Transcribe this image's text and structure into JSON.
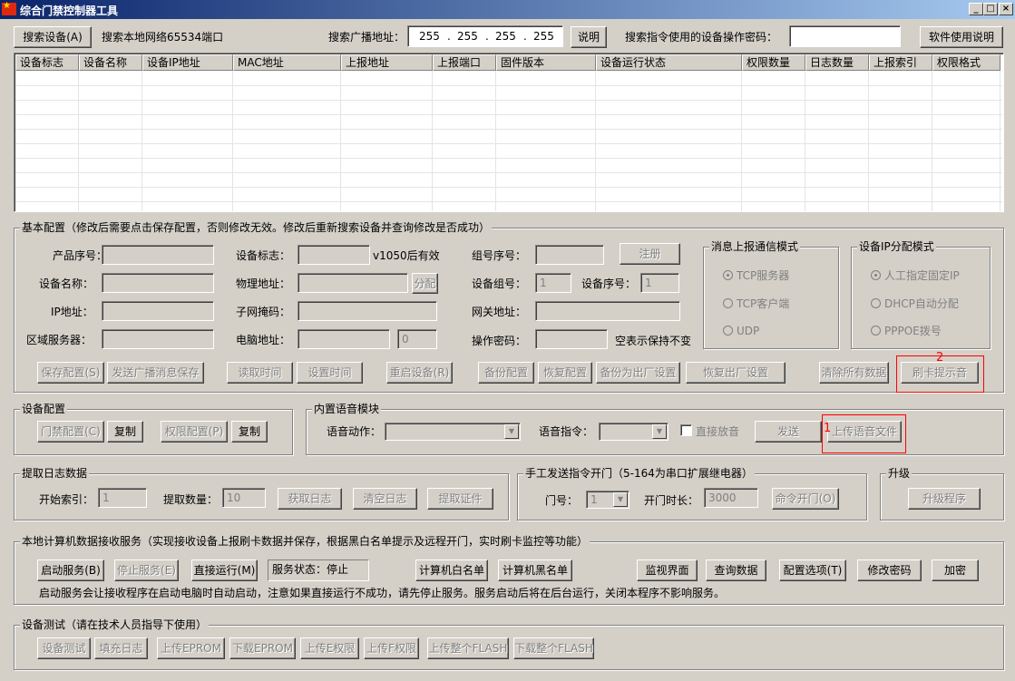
{
  "window": {
    "title": "综合门禁控制器工具",
    "minimize": "_",
    "maximize": "□",
    "close": "×"
  },
  "top": {
    "search_button": "搜索设备(A)",
    "search_port_label": "搜索本地网络65534端口",
    "broadcast_label": "搜索广播地址：",
    "broadcast_octets": [
      "255",
      "255",
      "255",
      "255"
    ],
    "explain_button": "说明",
    "password_label": "搜索指令使用的设备操作密码：",
    "password_value": "",
    "manual_button": "软件使用说明"
  },
  "device_list": {
    "columns": [
      "设备标志",
      "设备名称",
      "设备IP地址",
      "MAC地址",
      "上报地址",
      "上报端口",
      "固件版本",
      "设备运行状态",
      "权限数量",
      "日志数量",
      "上报索引",
      "权限格式"
    ]
  },
  "basic_config": {
    "title": "基本配置（修改后需要点击保存配置，否则修改无效。修改后重新搜索设备并查询修改是否成功）",
    "product_sn_label": "产品序号：",
    "device_name_label": "设备名称：",
    "ip_label": "IP地址：",
    "zone_server_label": "区域服务器：",
    "device_flag_label": "设备标志：",
    "version_note": "v1050后有效",
    "mac_label": "物理地址：",
    "assign_button": "分配",
    "subnet_label": "子网掩码：",
    "pc_addr_label": "电脑地址：",
    "pc_port_value": "0",
    "group_sn_label": "组号序号：",
    "register_button": "注册",
    "device_group_label": "设备组号：",
    "device_group_value": "1",
    "device_sn_label": "设备序号：",
    "device_sn_value": "1",
    "gateway_label": "网关地址：",
    "op_password_label": "操作密码：",
    "empty_keep_note": "空表示保持不变",
    "msg_mode": {
      "title": "消息上报通信模式",
      "options": [
        "TCP服务器",
        "TCP客户端",
        "UDP"
      ],
      "selected": 0
    },
    "ip_mode": {
      "title": "设备IP分配模式",
      "options": [
        "人工指定固定IP",
        "DHCP自动分配",
        "PPPOE拨号"
      ],
      "selected": 0
    },
    "buttons": [
      "保存配置(S)",
      "发送广播消息保存",
      "读取时间",
      "设置时间",
      "重启设备(R)",
      "备份配置",
      "恢复配置",
      "备份为出厂设置",
      "恢复出厂设置",
      "清除所有数据",
      "刷卡提示音"
    ],
    "marker_2": "2"
  },
  "device_config": {
    "title": "设备配置",
    "door_config_button": "门禁配置(C)",
    "copy1_button": "复制",
    "perm_config_button": "权限配置(P)",
    "copy2_button": "复制"
  },
  "voice": {
    "title": "内置语音模块",
    "action_label": "语音动作：",
    "command_label": "语音指令：",
    "direct_play_label": "直接放音",
    "send_button": "发送",
    "upload_button": "上传语音文件",
    "marker_1": "1"
  },
  "log": {
    "title": "提取日志数据",
    "start_index_label": "开始索引：",
    "start_index_value": "1",
    "count_label": "提取数量：",
    "count_value": "10",
    "get_log_button": "获取日志",
    "clear_log_button": "清空日志",
    "get_cert_button": "提取证件"
  },
  "manual_open": {
    "title": "手工发送指令开门（5-164为串口扩展继电器）",
    "door_label": "门号：",
    "door_value": "1",
    "duration_label": "开门时长：",
    "duration_value": "3000",
    "open_button": "命令开门(O)"
  },
  "upgrade": {
    "title": "升级",
    "button": "升级程序"
  },
  "service": {
    "title": "本地计算机数据接收服务（实现接收设备上报刷卡数据并保存，根据黑白名单提示及远程开门，实时刷卡监控等功能）",
    "start_button": "启动服务(B)",
    "stop_button": "停止服务(E)",
    "run_direct_button": "直接运行(M)",
    "status_text": "服务状态：停止",
    "whitelist_button": "计算机白名单",
    "blacklist_button": "计算机黑名单",
    "monitor_button": "监视界面",
    "query_button": "查询数据",
    "options_button": "配置选项(T)",
    "change_pwd_button": "修改密码",
    "encrypt_button": "加密",
    "note": "启动服务会让接收程序在启动电脑时自动启动，注意如果直接运行不成功，请先停止服务。服务启动后将在后台运行，关闭本程序不影响服务。"
  },
  "test": {
    "title": "设备测试（请在技术人员指导下使用）",
    "buttons": [
      "设备测试",
      "填充日志",
      "上传EPROM",
      "下载EPROM",
      "上传E权限",
      "上传F权限",
      "上传整个FLASH",
      "下载整个FLASH"
    ]
  }
}
